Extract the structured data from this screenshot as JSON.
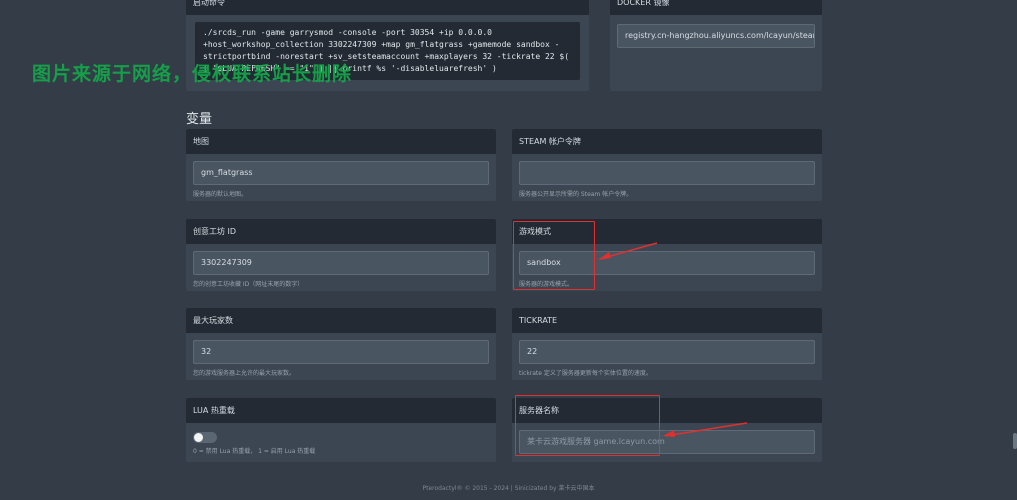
{
  "startup": {
    "title": "启动命令",
    "command": "./srcds_run -game garrysmod -console -port 30354 +ip 0.0.0.0\n+host_workshop_collection 3302247309 +map gm_flatgrass +gamemode sandbox -\nstrictportbind -norestart +sv_setsteamaccount +maxplayers 32 -tickrate 22 $(\n[ \"$LUA_REFRESH\" == \"1\" ] || printf %s '-disableluarefresh' )"
  },
  "docker": {
    "title": "DOCKER 镜像",
    "value": "registry.cn-hangzhou.aliyuncs.com/lcayun/steamcm"
  },
  "watermark": "图片来源于网络，侵权联系站长删除",
  "variables": {
    "section_title": "变量",
    "map": {
      "label": "地图",
      "value": "gm_flatgrass",
      "hint": "服务器的默认地图。"
    },
    "steam_token": {
      "label": "STEAM 帐户令牌",
      "value": "",
      "hint": "服务器公开显示所需的 Steam 帐户令牌。"
    },
    "workshop": {
      "label": "创意工坊 ID",
      "value": "3302247309",
      "hint": "您的创意工坊收藏 ID（网址末尾的数字）"
    },
    "gamemode": {
      "label": "游戏模式",
      "value": "sandbox",
      "hint": "服务器的游戏模式。"
    },
    "max_players": {
      "label": "最大玩家数",
      "value": "32",
      "hint": "您的游戏服务器上允许的最大玩家数。"
    },
    "tickrate": {
      "label": "TICKRATE",
      "value": "22",
      "hint": "tickrate 定义了服务器更新每个实体位置的速度。"
    },
    "lua_refresh": {
      "label": "LUA 热重载",
      "enabled": false,
      "hint": "0 = 禁用 Lua 热重载， 1 = 启用 Lua 热重载"
    },
    "server_name": {
      "label": "服务器名称",
      "value": "",
      "placeholder": "莱卡云游戏服务器 game.lcayun.com"
    }
  },
  "footer": "Pterodactyl® © 2015 - 2024 | Sinicizated by 莱卡云中国本",
  "colors": {
    "highlight": "#e03030",
    "watermark": "#13a84a",
    "background": "#333c47"
  }
}
